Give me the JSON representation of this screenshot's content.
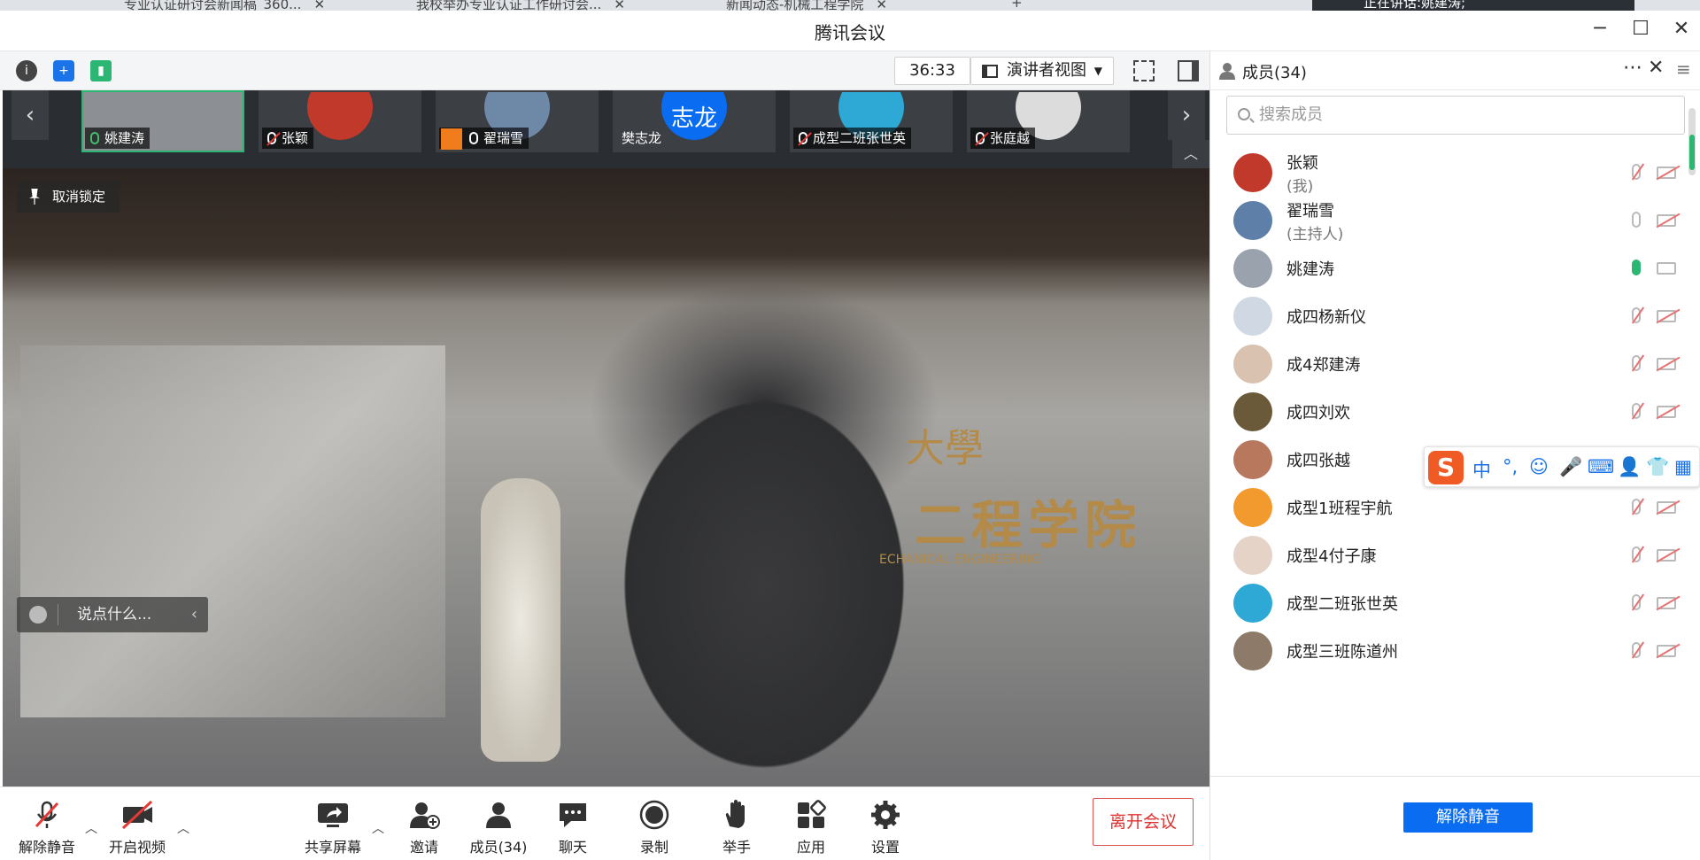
{
  "browser": {
    "tabs": [
      {
        "label": "专业认证研讨会新闻稿_360..."
      },
      {
        "label": "我校举办专业认证工作研讨会..."
      },
      {
        "label": "新闻动态-机械工程学院"
      }
    ],
    "notification": "正在讲话:姚建涛;"
  },
  "window": {
    "title": "腾讯会议"
  },
  "toolbar": {
    "timer": "36:33",
    "view_mode": "演讲者视图"
  },
  "thumbnails": [
    {
      "name": "姚建涛",
      "mic": "on",
      "active": true
    },
    {
      "name": "张颖",
      "mic": "muted"
    },
    {
      "name": "翟瑞雪",
      "mic": "host"
    },
    {
      "name": "樊志龙",
      "mic": "none",
      "avatar_text": "志龙"
    },
    {
      "name": "成型二班张世英",
      "mic": "muted"
    },
    {
      "name": "张庭越",
      "mic": "muted"
    }
  ],
  "video": {
    "unpin_label": "取消锁定",
    "chat_placeholder": "说点什么...",
    "wall_text": "二程学院",
    "wall_top": "大學",
    "wall_sub": "ECHANICAL ENGINEERING"
  },
  "controls": {
    "unmute": "解除静音",
    "start_video": "开启视频",
    "share_screen": "共享屏幕",
    "invite": "邀请",
    "members": "成员(34)",
    "chat": "聊天",
    "record": "录制",
    "raise_hand": "举手",
    "apps": "应用",
    "settings": "设置",
    "leave": "离开会议"
  },
  "panel": {
    "title": "成员(34)",
    "search_placeholder": "搜索成员",
    "unmute_all": "解除静音",
    "members": [
      {
        "name": "张颖",
        "role": "(我)",
        "mic": "muted",
        "cam": "off",
        "color": "#c0392b"
      },
      {
        "name": "翟瑞雪",
        "role": "(主持人)",
        "mic": "idle",
        "cam": "off",
        "color": "#5d7fa8"
      },
      {
        "name": "姚建涛",
        "role": "",
        "mic": "on",
        "cam": "idle",
        "color": "#9aa3ad"
      },
      {
        "name": " 成四杨新仪",
        "role": "",
        "mic": "muted",
        "cam": "off",
        "color": "#cfd8e3"
      },
      {
        "name": "成4郑建涛",
        "role": "",
        "mic": "muted",
        "cam": "off",
        "color": "#d9c2b0"
      },
      {
        "name": "成四刘欢",
        "role": "",
        "mic": "muted",
        "cam": "off",
        "color": "#6b5a3a"
      },
      {
        "name": "成四张越",
        "role": "",
        "mic": "muted",
        "cam": "off",
        "color": "#b7785d"
      },
      {
        "name": "成型1班程宇航",
        "role": "",
        "mic": "muted",
        "cam": "off",
        "color": "#f29a2e"
      },
      {
        "name": "成型4付子康",
        "role": "",
        "mic": "muted",
        "cam": "off",
        "color": "#e6d3c7"
      },
      {
        "name": "成型二班张世英",
        "role": "",
        "mic": "muted",
        "cam": "off",
        "color": "#2ea9d6"
      },
      {
        "name": "成型三班陈道州",
        "role": "",
        "mic": "muted",
        "cam": "off",
        "color": "#8d7a68"
      }
    ]
  },
  "ime": {
    "items": [
      "中",
      "°,",
      "☺",
      "🎤",
      "⌨",
      "👤",
      "👕",
      "▦"
    ]
  }
}
